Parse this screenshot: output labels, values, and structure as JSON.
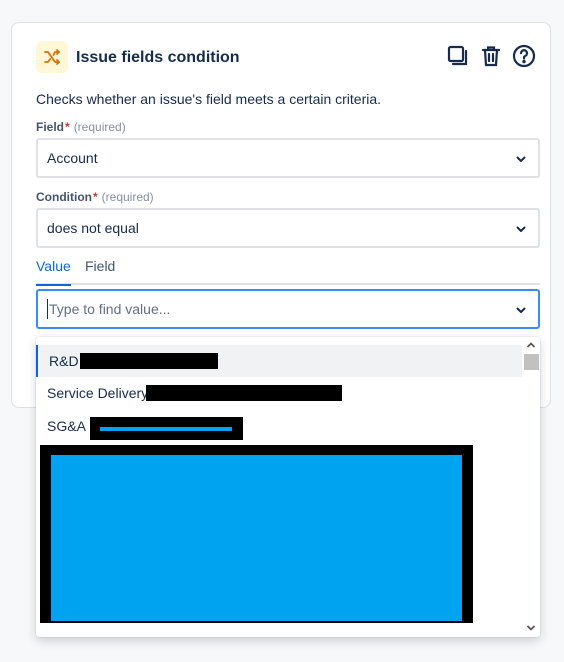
{
  "card": {
    "title": "Issue fields condition",
    "description": "Checks whether an issue's field meets a certain criteria."
  },
  "icons": {
    "header": "shuffle-icon",
    "copy": "copy-icon",
    "delete": "trash-icon",
    "help": "help-icon",
    "chevron": "chevron-down-icon"
  },
  "field": {
    "label": "Field",
    "required_marker": "*",
    "required_hint": "(required)",
    "value": "Account"
  },
  "condition": {
    "label": "Condition",
    "required_marker": "*",
    "required_hint": "(required)",
    "value": "does not equal"
  },
  "tabs": [
    {
      "label": "Value",
      "active": true
    },
    {
      "label": "Field",
      "active": false
    }
  ],
  "value_input": {
    "placeholder": "Type to find value..."
  },
  "dropdown": {
    "options": [
      {
        "label": "R&D",
        "selected": true
      },
      {
        "label": "Service Delivery",
        "selected": false
      },
      {
        "label": "SG&A",
        "selected": false
      }
    ]
  },
  "colors": {
    "accent": "#0c66e4",
    "header_icon_bg": "#fff7d6",
    "header_icon_fg": "#d97008",
    "redaction_fill": "#00a3ef"
  }
}
